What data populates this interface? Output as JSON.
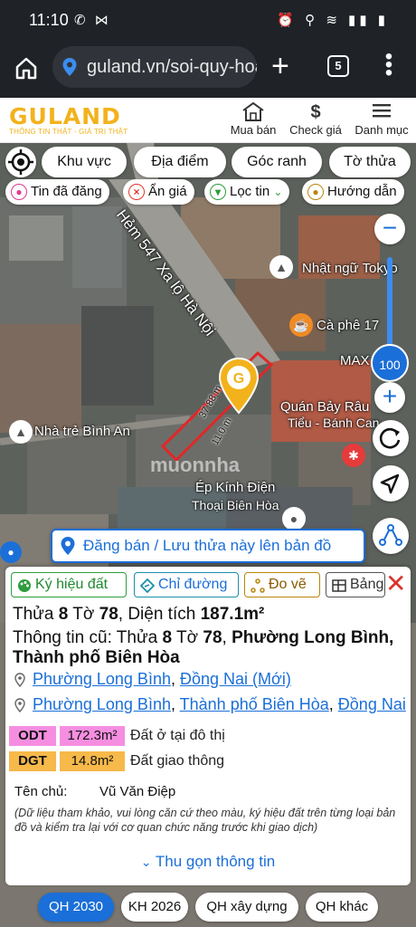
{
  "status": {
    "time": "11:10",
    "left_icons": "✆ ⋈",
    "right_icons": "⏰ ⚲ ≋ ▮▮ ▮"
  },
  "browser": {
    "url": "guland.vn/soi-quy-hoạ",
    "tab_count": "5"
  },
  "header": {
    "logo": "GULAND",
    "tagline": "THÔNG TIN THẬT - GIÁ TRỊ THẬT",
    "nav": [
      {
        "label": "Mua bán",
        "icon": "house-icon"
      },
      {
        "label": "Check giá",
        "icon": "dollar-icon"
      },
      {
        "label": "Danh mục",
        "icon": "menu-icon"
      }
    ]
  },
  "map_filters": [
    "Khu vực",
    "Địa điểm",
    "Góc ranh",
    "Tờ thửa"
  ],
  "map_tools": [
    {
      "label": "Tin đã đăng",
      "icon": "people-icon",
      "color": "#e23b8f"
    },
    {
      "label": "Ẩn giá",
      "icon": "x-circle-icon",
      "color": "#e0362c"
    },
    {
      "label": "Lọc tin",
      "icon": "filter-icon",
      "color": "#2e9c3c"
    },
    {
      "label": "Hướng dẫn",
      "icon": "guide-icon",
      "color": "#b8860b"
    }
  ],
  "zoom": {
    "level": "100"
  },
  "map_labels": {
    "road": "Hẻm 547 Xa lộ Hà Nội",
    "poi1": "Nhật ngữ Tokyo",
    "poi2": "Cà phê 17",
    "poi3": "MAX",
    "poi4": "Quán Bảy Râu",
    "poi5": "Tiểu - Bánh Can",
    "poi6": "Nhà trẻ Bình An",
    "poi7": "Ép Kính Điện",
    "poi8": "Thoại Biên Hòa",
    "dim1": "37.88 m",
    "dim2": "11.0 m",
    "watermark": "muonnha"
  },
  "post_bar": "Đăng bán / Lưu thửa này lên bản đồ",
  "card": {
    "tools": [
      {
        "label": "Ký hiệu đất",
        "icon": "palette-icon"
      },
      {
        "label": "Chỉ đường",
        "icon": "directions-icon"
      },
      {
        "label": "Đo vẽ",
        "icon": "measure-icon"
      },
      {
        "label": "Bảng",
        "icon": "table-icon"
      }
    ],
    "parcel_prefix": "Thửa",
    "parcel_no": "8",
    "sheet_prefix": "Tờ",
    "sheet_no": "78",
    "area_prefix": ", Diện tích",
    "area": "187.1m²",
    "old_prefix": "Thông tin cũ: Thửa",
    "old_parcel": "8",
    "old_sheet_prefix": "Tờ",
    "old_sheet": "78",
    "old_ward": "Phường Long Bình, Thành phố Biên Hòa",
    "addr1": {
      "ward": "Phường Long Bình",
      "province": "Đồng Nai (Mới)"
    },
    "addr2": {
      "ward": "Phường Long Bình",
      "city": "Thành phố Biên Hòa",
      "province": "Đồng Nai"
    },
    "land_uses": [
      {
        "code": "ODT",
        "area": "172.3m²",
        "desc": "Đất ở tại đô thị",
        "color": "#f58ee0"
      },
      {
        "code": "DGT",
        "area": "14.8m²",
        "desc": "Đất giao thông",
        "color": "#f6b94a"
      }
    ],
    "owner_label": "Tên chủ:",
    "owner": "Vũ Văn Điệp",
    "note": "(Dữ liệu tham khảo, vui lòng căn cứ theo màu, ký hiệu đất trên từng loại bản đồ và kiểm tra lại với cơ quan chức năng trước khi giao dịch)",
    "collapse": "Thu gọn thông tin"
  },
  "bottom_tabs": [
    "QH 2030",
    "KH 2026",
    "QH xây dựng",
    "QH khác"
  ]
}
